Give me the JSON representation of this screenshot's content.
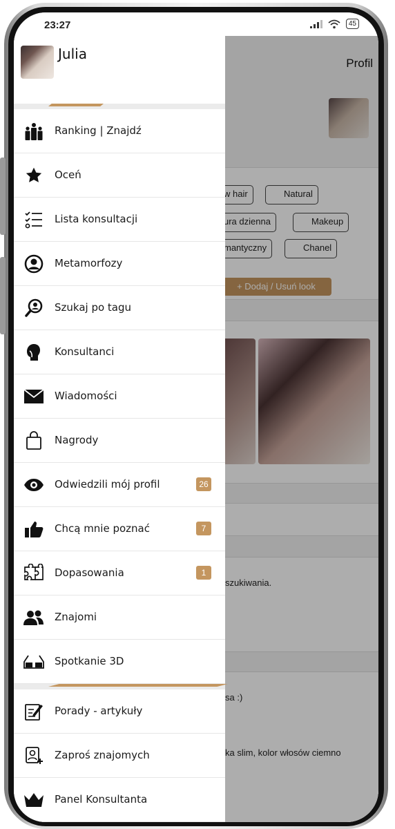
{
  "status_bar": {
    "time": "23:27",
    "battery": "45"
  },
  "background_page": {
    "title": "Profil",
    "tags": [
      "w hair",
      "Natural",
      "ura dzienna",
      "Makeup",
      "mantyczny",
      "Chanel"
    ],
    "add_look_label": "+ Dodaj / Usuń look",
    "text_1": "szukiwania.",
    "text_2": "sa :)",
    "text_3": "ka slim, kolor włosów ciemno"
  },
  "drawer": {
    "user_name": "Julia",
    "menu": [
      {
        "label": "Ranking | Znajdź",
        "icon": "ranking-people-icon"
      },
      {
        "label": "Oceń",
        "icon": "star-icon"
      },
      {
        "label": "Lista konsultacji",
        "icon": "checklist-icon"
      },
      {
        "label": "Metamorfozy",
        "icon": "person-circle-icon"
      },
      {
        "label": "Szukaj po tagu",
        "icon": "search-person-icon"
      },
      {
        "label": "Konsultanci",
        "icon": "head-silhouette-icon"
      },
      {
        "label": "Wiadomości",
        "icon": "envelope-icon"
      },
      {
        "label": "Nagrody",
        "icon": "shopping-bag-icon"
      },
      {
        "label": "Odwiedzili mój profil",
        "icon": "eye-icon",
        "badge": "26"
      },
      {
        "label": "Chcą mnie poznać",
        "icon": "thumbs-up-icon",
        "badge": "7"
      },
      {
        "label": "Dopasowania",
        "icon": "puzzle-icon",
        "badge": "1"
      },
      {
        "label": "Znajomi",
        "icon": "friends-icon"
      },
      {
        "label": "Spotkanie 3D",
        "icon": "3d-glasses-icon"
      }
    ],
    "menu_secondary": [
      {
        "label": "Porady - artykuły",
        "icon": "edit-article-icon"
      },
      {
        "label": "Zaproś znajomych",
        "icon": "invite-contact-icon"
      },
      {
        "label": "Panel Konsultanta",
        "icon": "crown-icon"
      }
    ]
  },
  "colors": {
    "accent": "#c4965f",
    "overlay": "rgba(0,0,0,0.32)"
  }
}
